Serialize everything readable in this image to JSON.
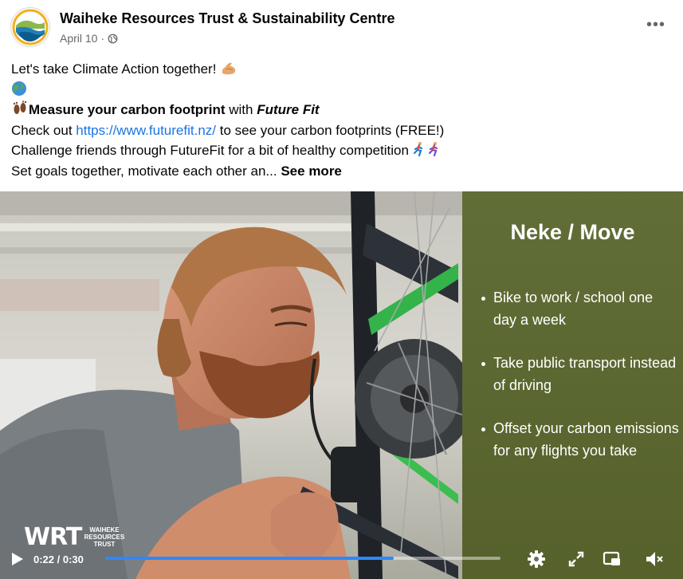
{
  "post": {
    "page_name": "Waiheke Resources Trust & Sustainability Centre",
    "date": "April 10",
    "date_separator": "·",
    "more_label": "•••"
  },
  "caption": {
    "line1": "Let's take Climate Action together!",
    "line3_bold": "Measure your carbon footprint",
    "line3_mid": " with ",
    "line3_italic": "Future Fit",
    "line4_pre": "Check out ",
    "line4_link": "https://www.futurefit.nz/",
    "line4_post": " to see your carbon footprints (FREE!)",
    "line5": "Challenge friends through FutureFit for a bit of healthy competition",
    "line6": "Set goals together, motivate each other an...",
    "see_more": "See more"
  },
  "video": {
    "panel_title": "Neke / Move",
    "bullets": [
      "Bike to work / school one day a week",
      "Take public transport instead of driving",
      "Offset your carbon emissions for any flights you take"
    ],
    "logo_text": "WRT",
    "logo_subtext": "WAIHEKE RESOURCES TRUST",
    "current_time": "0:22",
    "duration": "0:30",
    "time_separator": " / ",
    "progress": 0.73
  },
  "colors": {
    "link": "#1b74e4",
    "progress": "#2d88ff",
    "panel_green": "#5f6e34"
  },
  "icons": [
    "globe-icon",
    "flexed-biceps-icon",
    "earth-globe-icon",
    "footprints-icon",
    "runner-icon",
    "play-icon",
    "settings-icon",
    "fullscreen-icon",
    "picture-in-picture-icon",
    "mute-icon"
  ]
}
